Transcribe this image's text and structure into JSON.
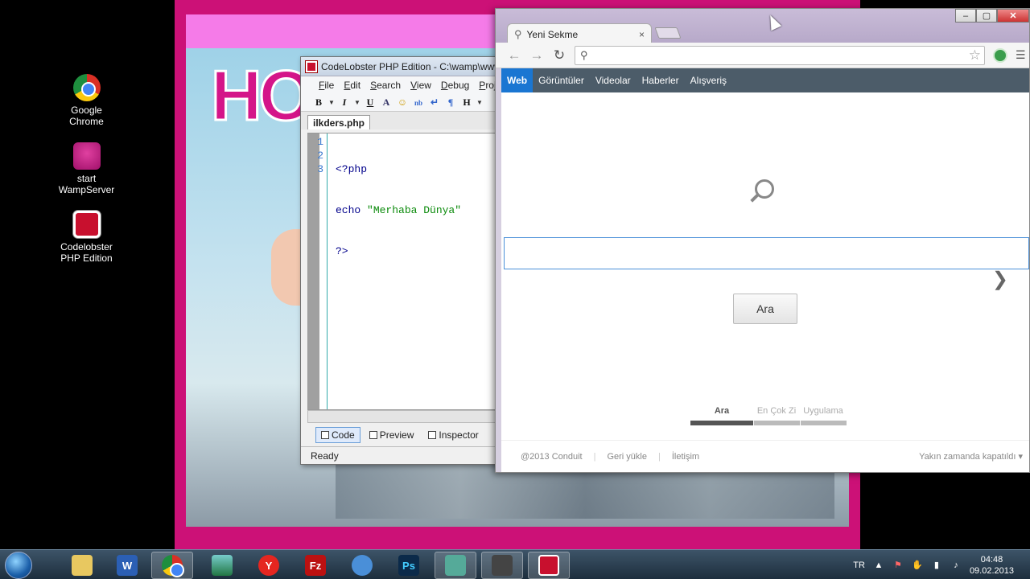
{
  "desktop": {
    "icons": [
      {
        "label_line1": "Google",
        "label_line2": "Chrome",
        "icon": "chrome-icon"
      },
      {
        "label_line1": "start",
        "label_line2": "WampServer",
        "icon": "wampserver-icon"
      },
      {
        "label_line1": "Codelobster",
        "label_line2": "PHP Edition",
        "icon": "codelobster-icon"
      }
    ]
  },
  "background_page": {
    "logo_text": "HO"
  },
  "codelobster": {
    "title": "CodeLobster PHP Edition - C:\\wamp\\www\\",
    "menu": [
      "File",
      "Edit",
      "Search",
      "View",
      "Debug",
      "Proj"
    ],
    "file_tab": "ilkders.php",
    "line_numbers": [
      "1",
      "2",
      "3"
    ],
    "code_lines": {
      "line1": "<?php",
      "line2_kw": "echo ",
      "line2_str": "\"Merhaba Dünya\"",
      "line3": "?>"
    },
    "view_tabs": [
      "Code",
      "Preview",
      "Inspector"
    ],
    "status": "Ready"
  },
  "chrome": {
    "tab_title": "Yeni Sekme",
    "tab_close": "×",
    "search_nav": [
      "Web",
      "Görüntüler",
      "Videolar",
      "Haberler",
      "Alışveriş"
    ],
    "search_button": "Ara",
    "next_arrow": "❯",
    "bottom_tabs": [
      "Ara",
      "En Çok Zi",
      "Uygulama"
    ],
    "footer": {
      "copyright": "@2013 Conduit",
      "restore": "Geri yükle",
      "contact": "İletişim",
      "closing_soon": "Yakın zamanda kapatıldı ▾"
    },
    "window_buttons": [
      "‒",
      "▢",
      "✕"
    ]
  },
  "taskbar": {
    "apps": [
      {
        "name": "explorer",
        "label": ""
      },
      {
        "name": "word",
        "label": "W"
      },
      {
        "name": "chrome",
        "label": ""
      },
      {
        "name": "image-viewer",
        "label": ""
      },
      {
        "name": "yandex",
        "label": "Y"
      },
      {
        "name": "filezilla",
        "label": "Fz"
      },
      {
        "name": "audio",
        "label": ""
      },
      {
        "name": "photoshop",
        "label": "Ps"
      },
      {
        "name": "messenger",
        "label": ""
      },
      {
        "name": "wamp",
        "label": ""
      },
      {
        "name": "codelobster",
        "label": ""
      }
    ],
    "language": "TR",
    "time": "04:48",
    "date": "09.02.2013"
  }
}
